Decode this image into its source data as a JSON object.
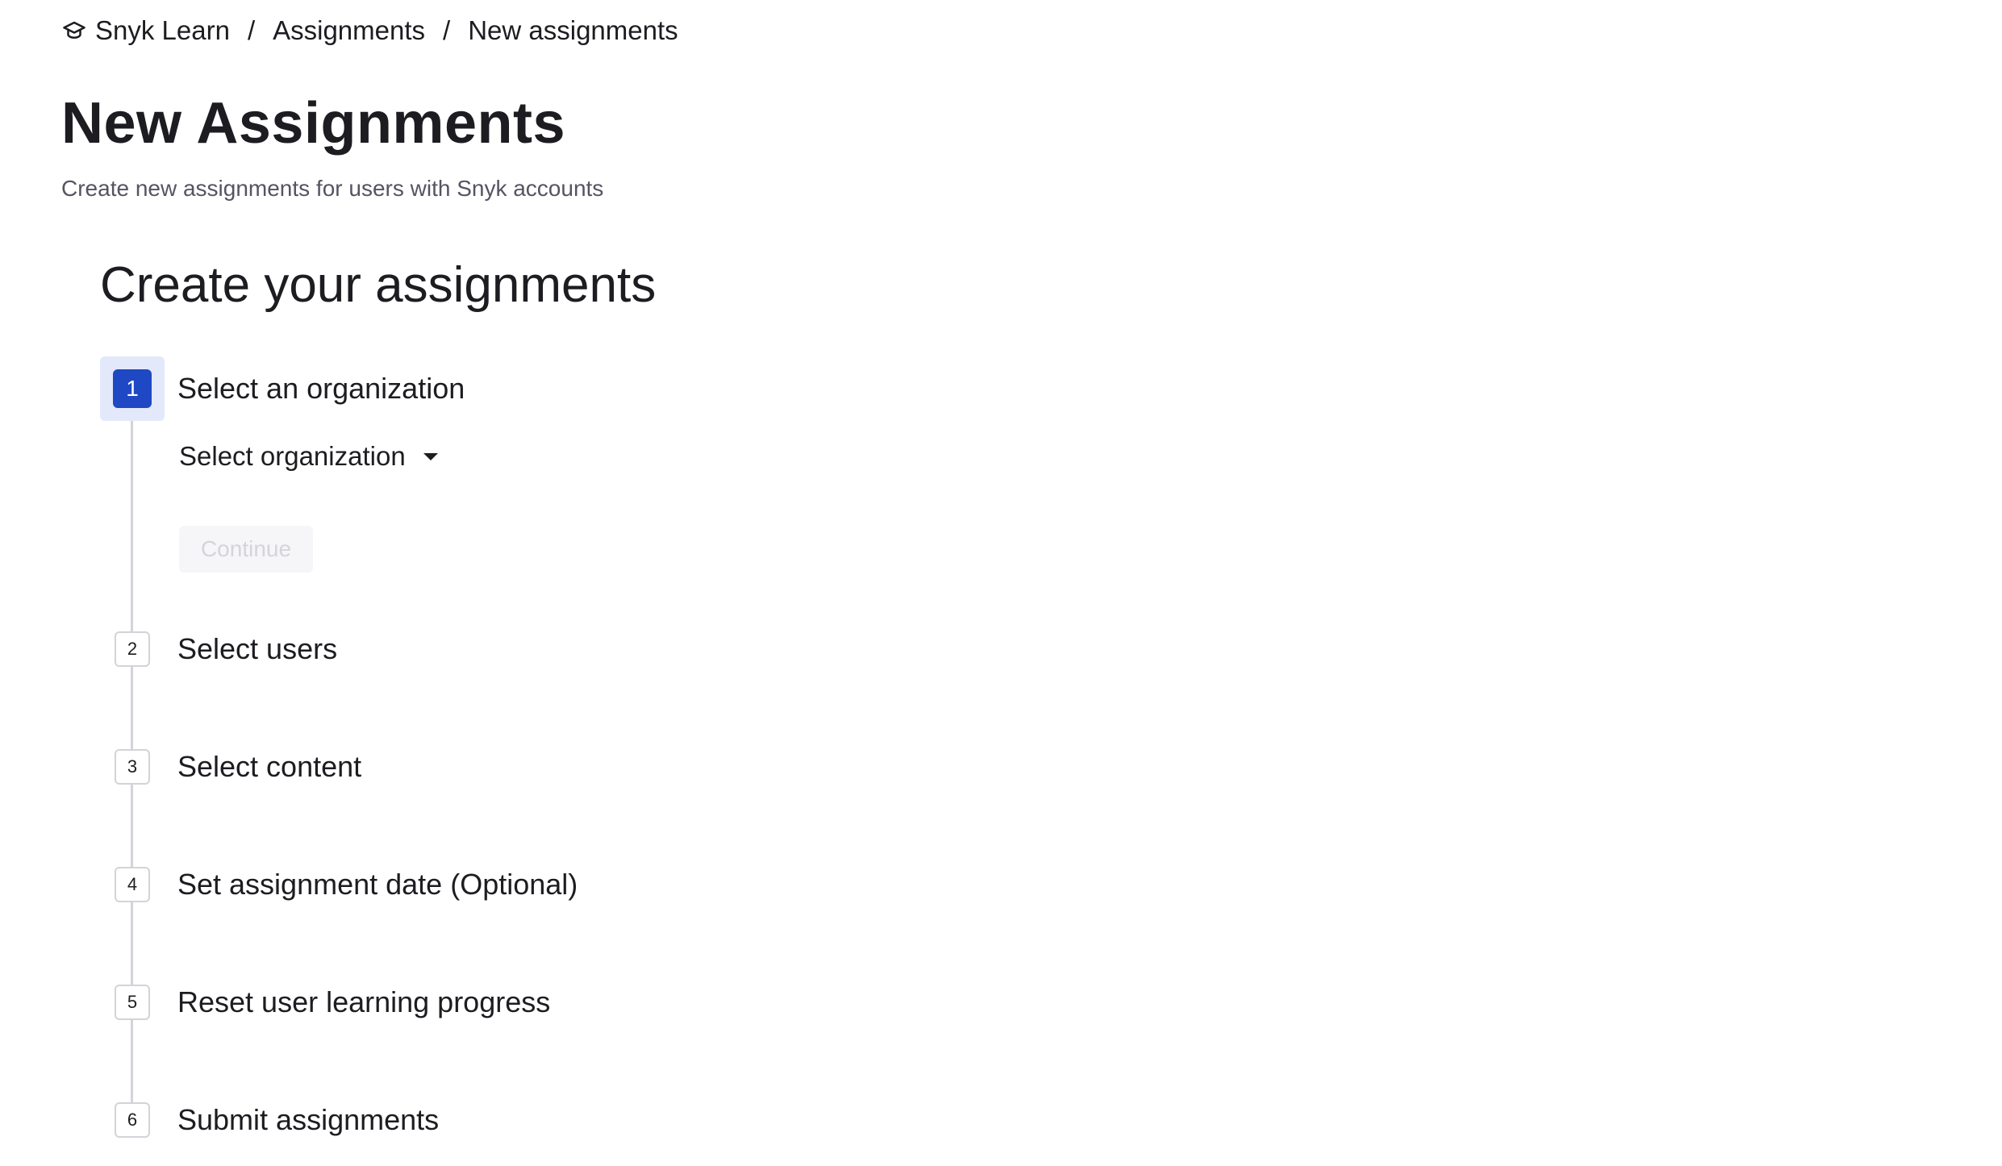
{
  "breadcrumb": {
    "icon": "graduation-cap-icon",
    "items": [
      "Snyk Learn",
      "Assignments",
      "New assignments"
    ],
    "separator": "/"
  },
  "header": {
    "title": "New Assignments",
    "subtitle": "Create new assignments for users with Snyk accounts"
  },
  "wizard": {
    "title": "Create your assignments",
    "steps": [
      {
        "number": "1",
        "label": "Select an organization",
        "state": "active"
      },
      {
        "number": "2",
        "label": "Select users",
        "state": "pending"
      },
      {
        "number": "3",
        "label": "Select content",
        "state": "pending"
      },
      {
        "number": "4",
        "label": "Set assignment date (Optional)",
        "state": "pending"
      },
      {
        "number": "5",
        "label": "Reset user learning progress",
        "state": "pending"
      },
      {
        "number": "6",
        "label": "Submit assignments",
        "state": "pending"
      }
    ],
    "org_select": {
      "label": "Select organization",
      "icon": "chevron-down-icon"
    },
    "continue_button": {
      "label": "Continue",
      "disabled": true
    }
  },
  "colors": {
    "accent": "#1f49c4",
    "active_step_bg": "#e3e9fb",
    "text": "#1c1c21",
    "muted_text": "#555463",
    "disabled_text": "#d4d4da"
  }
}
